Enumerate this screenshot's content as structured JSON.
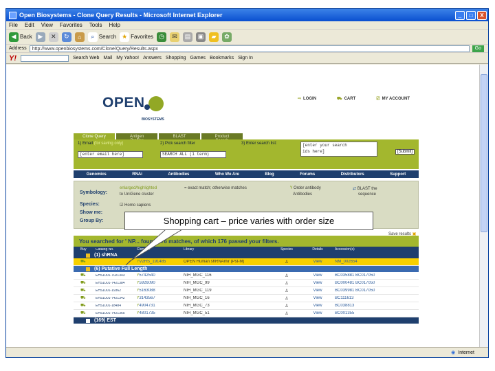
{
  "window": {
    "title": "Open Biosystems - Clone Query Results - Microsoft Internet Explorer",
    "minimize": "_",
    "maximize": "□",
    "close": "X"
  },
  "menu": [
    "File",
    "Edit",
    "View",
    "Favorites",
    "Tools",
    "Help"
  ],
  "toolbar": {
    "back": "Back",
    "search": "Search",
    "favorites": "Favorites"
  },
  "address": {
    "label": "Address",
    "url": "http://www.openbiosystems.com/Clone/Query/Results.aspx",
    "go": "Go"
  },
  "yahoo": {
    "logo": "Y!",
    "search_web": "Search Web",
    "mail": "Mail",
    "my_yahoo": "My Yahoo!",
    "answers": "Answers",
    "shopping": "Shopping",
    "games": "Games",
    "bookmarks": "Bookmarks",
    "signin": "Sign In"
  },
  "site": {
    "login": "LOGIN",
    "cart": "CART",
    "my_account": "MY ACCOUNT",
    "logo_word": "OPEN",
    "logo_sub": "BIOSYSTEMS",
    "tabs": [
      "Clone Query",
      "Antigen Profiler",
      "BLAST",
      "Product Search"
    ],
    "step1": "1) Email",
    "step1_hint": "(for saving only)",
    "step1_value": "[enter email here]",
    "step2": "2) Pick search filter",
    "step2_value": "SEARCH ALL (1 term)",
    "step3": "3) Enter search list:",
    "step3_value_1": "[enter your search",
    "step3_value_2": "ids here]",
    "submit": "[Submit]",
    "nav": [
      "Genomics",
      "RNAi",
      "Antibodies",
      "Who We Are",
      "Blog",
      "Forums",
      "Distributors",
      "Support"
    ],
    "filters": {
      "symbology": "Symbology:",
      "symbology_hint": "enlarged/highlighted",
      "symbology_text": "= exact match; otherwise matches",
      "gene_text": "to UniGene cluster",
      "order_text": "Order antibody",
      "order_text2": "Antibodies",
      "blast_text": "BLAST the",
      "blast_text2": "sequence",
      "species": "Species:",
      "species_value": "Homo sapiens",
      "show": "Show me:",
      "group": "Group By:",
      "save": "Save results"
    },
    "results_title": "You searched for ' NP... found 176 matches, of which 176 passed your filters.",
    "columns": [
      "Buy",
      "Catalog No.",
      "Clone ID",
      "Library",
      "Species",
      "Details",
      "Accession(s)"
    ],
    "groups": {
      "shrna": "(1) shRNA",
      "full_length": "(6) Putative Full Length",
      "est": "(169) EST"
    },
    "rows": [
      {
        "cat": "",
        "clone": "V2HS_191485",
        "lib": "OPEN Human shRNAmir (Pst-M)",
        "details": "View",
        "acc": "NM_002654",
        "hl": true
      },
      {
        "cat": "EHS1001-7021343",
        "clone": "5742540",
        "lib": "NIH_MGC_116",
        "details": "View",
        "acc": "BC035881 BC017050",
        "hl": false
      },
      {
        "cat": "EHS1001-7421384",
        "clone": "5926090",
        "lib": "NIH_MGC_99",
        "details": "View",
        "acc": "BC000481 BC017050",
        "hl": false
      },
      {
        "cat": "EHS1001-19362",
        "clone": "5163088",
        "lib": "NIH_MGC_119",
        "details": "View",
        "acc": "BC039981 BC017050",
        "hl": false
      },
      {
        "cat": "EHS1001-7421342",
        "clone": "3143567",
        "lib": "NIH_MGC_16",
        "details": "View",
        "acc": "BC111613",
        "hl": false
      },
      {
        "cat": "EHS1001-18484",
        "clone": "4904731",
        "lib": "NIH_MGC_73",
        "details": "View",
        "acc": "BC038813",
        "hl": false
      },
      {
        "cat": "EHS1001-7421365",
        "clone": "4801735",
        "lib": "NIH_MGC_51",
        "details": "View",
        "acc": "BC001355",
        "hl": false
      }
    ]
  },
  "callout": "Shopping cart – price varies with order size",
  "status": {
    "zone": "Internet"
  }
}
